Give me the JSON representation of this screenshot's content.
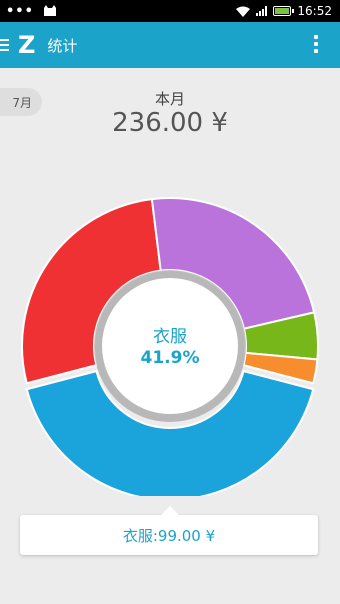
{
  "status_bar": {
    "time": "16:52",
    "notifications": "•••"
  },
  "app_bar": {
    "logo": "Z",
    "title": "统计"
  },
  "month_chip": "7月",
  "summary": {
    "period_label": "本月",
    "total": "236.00 ¥"
  },
  "selection": {
    "label": "衣服",
    "percent": "41.9%",
    "tooltip": "衣服:99.00 ¥"
  },
  "chart_data": {
    "type": "pie",
    "values": [
      41.9,
      27.1,
      23.3,
      5.1,
      2.6
    ],
    "labels": [
      "衣服",
      "",
      "",
      "",
      ""
    ],
    "colors": [
      "#1ba3db",
      "#f03134",
      "#bb73dc",
      "#78b719",
      "#f78d2c"
    ],
    "selected_index": 0
  }
}
